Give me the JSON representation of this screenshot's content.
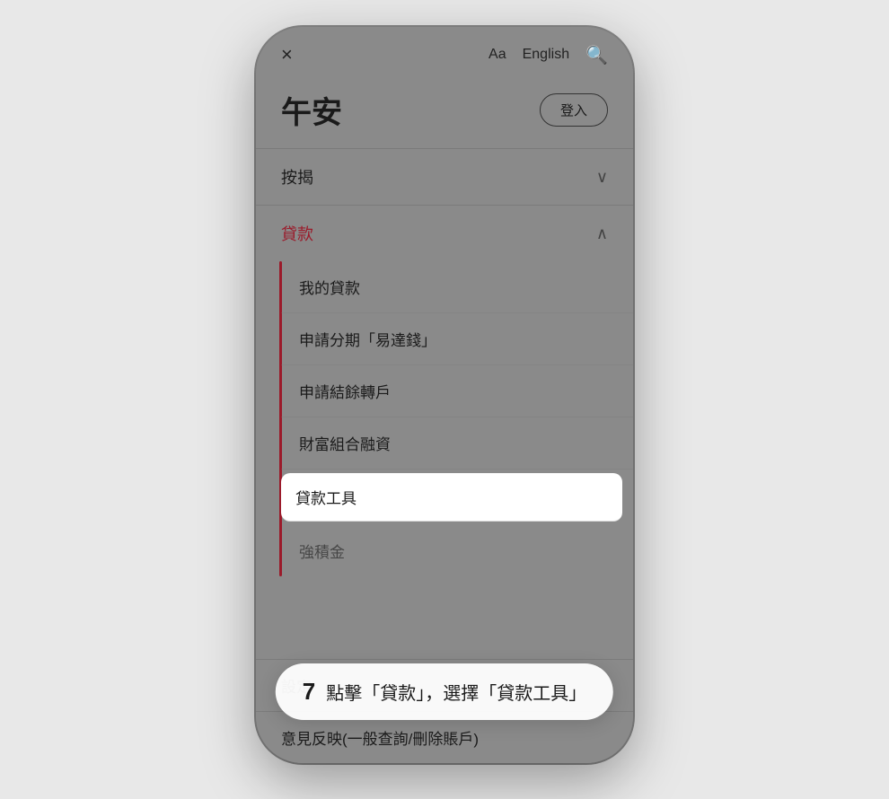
{
  "phone": {
    "topBar": {
      "closeIcon": "×",
      "fontSizeIcon": "Aa",
      "language": "English",
      "searchIcon": "🔍"
    },
    "greeting": "午安",
    "loginButton": "登入",
    "menu": {
      "sections": [
        {
          "label": "按揭",
          "expanded": false,
          "chevron": "∨"
        },
        {
          "label": "貸款",
          "expanded": true,
          "chevron": "∧",
          "items": [
            {
              "text": "我的貸款",
              "highlighted": false
            },
            {
              "text": "申請分期「易達錢」",
              "highlighted": false
            },
            {
              "text": "申請結餘轉戶",
              "highlighted": false
            },
            {
              "text": "財富組合融資",
              "highlighted": false
            },
            {
              "text": "貸款工具",
              "highlighted": true
            },
            {
              "text": "強積金",
              "highlighted": false,
              "partial": true
            }
          ]
        }
      ]
    },
    "bottomItems": [
      {
        "text": "設定"
      },
      {
        "text": "意見反映(一般查詢/刪除賬戶)"
      }
    ]
  },
  "instruction": {
    "number": "7",
    "text": "點擊「貸款」，選擇「貸款工具」"
  }
}
